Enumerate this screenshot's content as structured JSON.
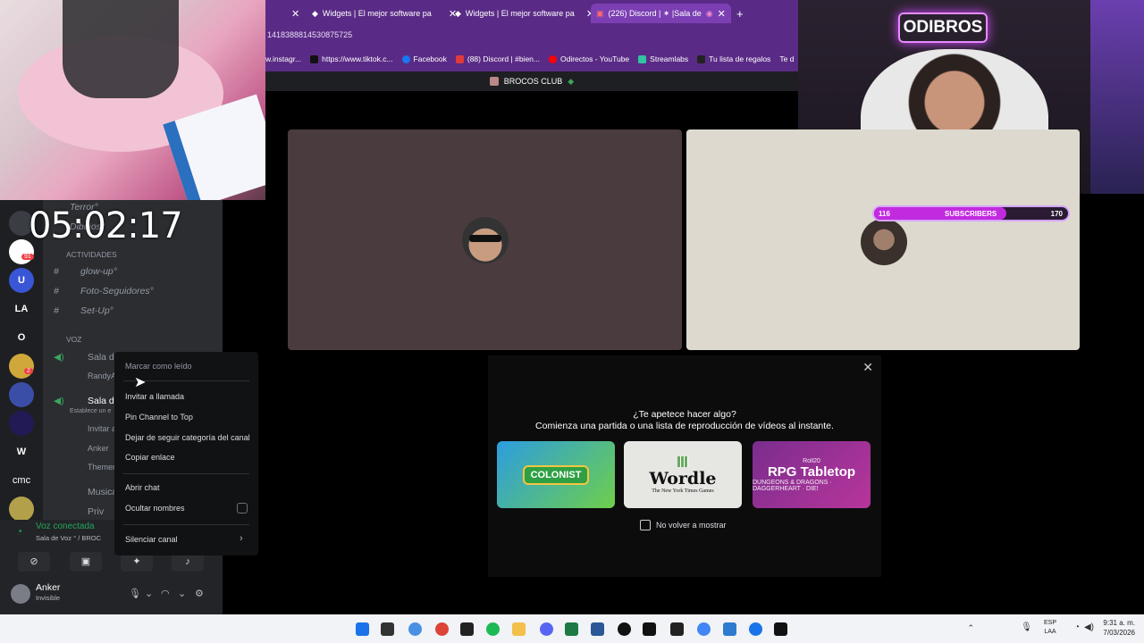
{
  "browser": {
    "tabs": [
      {
        "label": "Widgets | El mejor software pa",
        "icon": "widgets-icon"
      },
      {
        "label": "Widgets | El mejor software pa",
        "icon": "widgets-icon"
      },
      {
        "label": "(226) Discord | ✶ |Sala de",
        "icon": "discord-icon",
        "active": true
      }
    ],
    "new_tab": "+",
    "url": "1418388814530875725",
    "bookmarks": [
      "w.instagr...",
      "https://www.tiktok.c...",
      "Facebook",
      "(88) Discord | #bien...",
      "Odirectos - YouTube",
      "Streamlabs",
      "Tu lista de regalos",
      "Te d"
    ],
    "server_title": "BROCOS CLUB"
  },
  "timer": "05:02:17",
  "stream_overlay": {
    "neon_sign": "ODIBROS",
    "subs_current": "116",
    "subs_label": "SUBSCRIBERS",
    "subs_goal": "170",
    "subs_progress": 0.68
  },
  "discord": {
    "server_icons": [
      "LA",
      "O",
      "W",
      "cmc"
    ],
    "badges": {
      "first": "91",
      "second": "2"
    },
    "channels": {
      "terror": "Terror°",
      "dibujos": "Dibujos°",
      "cat_actividades": "ACTIVIDADES",
      "glowup": "glow-up°",
      "fotoseg": "Foto-Seguidores°",
      "setup": "Set-Up°",
      "cat_voz": "VOZ",
      "sala1": "Sala de",
      "randy": "RandyA",
      "sala2": "Sala de",
      "sala2_status": "Establece un e",
      "invitar": "Invitar a",
      "anker": "Anker",
      "themer": "Themer",
      "musica": "Musica",
      "priv": "Priv"
    },
    "voice": {
      "status": "Voz conectada",
      "sub": "Sala de Voz ° / BROC"
    },
    "user": {
      "name": "Anker",
      "status": "Invisible"
    }
  },
  "context_menu": {
    "mark_read": "Marcar como leído",
    "invite": "Invitar a llamada",
    "pin": "Pin Channel to Top",
    "unfollow": "Dejar de seguir categoría del canal",
    "copy": "Copiar enlace",
    "open_chat": "Abrir chat",
    "hide_names": "Ocultar nombres",
    "mute": "Silenciar canal"
  },
  "activity": {
    "line1": "¿Te apetece hacer algo?",
    "line2": "Comienza una partida o una lista de reproducción de vídeos al instante.",
    "cards": {
      "colonist": "COLONIST",
      "wordle": "Wordle",
      "wordle_sub": "The New York Times Games",
      "rpg_brand": "Roll20",
      "rpg": "RPG Tabletop",
      "rpg_sub": "DUNGEONS & DRAGONS · DAGGERHEART · DIE!"
    },
    "dont_show": "No volver a mostrar"
  },
  "taskbar": {
    "lang": "ESP",
    "lang2": "LAA",
    "time": "9:31 a. m.",
    "date": "7/03/2026"
  }
}
